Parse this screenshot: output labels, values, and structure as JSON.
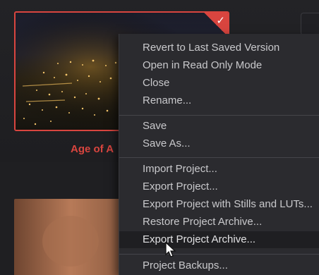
{
  "project": {
    "title": "Age of A",
    "badge_icon": "check-icon",
    "badge_color": "#d9453f"
  },
  "menu": {
    "groups": [
      [
        "Revert to Last Saved Version",
        "Open in Read Only Mode",
        "Close",
        "Rename..."
      ],
      [
        "Save",
        "Save As..."
      ],
      [
        "Import Project...",
        "Export Project...",
        "Export Project with Stills and LUTs...",
        "Restore Project Archive...",
        "Export Project Archive..."
      ],
      [
        "Project Backups..."
      ]
    ],
    "hovered": "Export Project Archive..."
  },
  "colors": {
    "accent": "#d9453f",
    "menu_bg": "#2b2b2f",
    "menu_text": "#c9c9cc",
    "page_bg": "#1f1f22"
  }
}
